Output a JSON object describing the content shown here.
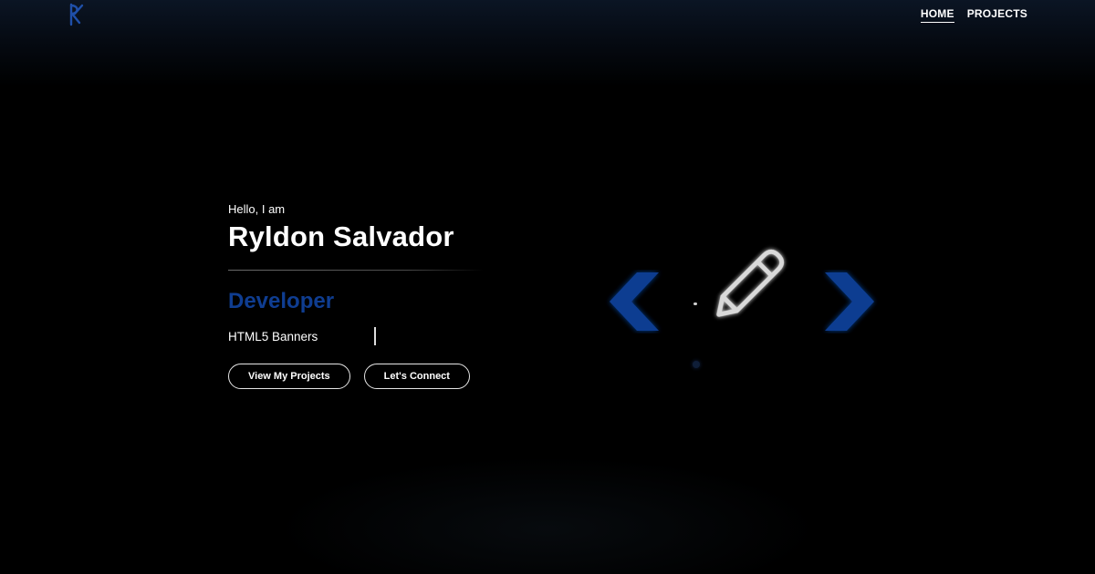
{
  "brand": {
    "logo_icon": "rs-logo-icon",
    "logo_color": "#1f4fa8"
  },
  "nav": {
    "items": [
      {
        "label": "HOME",
        "active": true
      },
      {
        "label": "PROJECTS",
        "active": false
      }
    ]
  },
  "hero": {
    "greeting": "Hello, I am",
    "name": "Ryldon Salvador",
    "role": "Developer",
    "typed_text": "HTML5 Banners",
    "buttons": {
      "view_projects": "View My Projects",
      "connect": "Let's Connect"
    }
  },
  "carousel": {
    "current_icon": "pencil-icon",
    "prev_icon": "chevron-left-icon",
    "next_icon": "chevron-right-icon",
    "arrow_color": "#0f3d91"
  },
  "colors": {
    "background": "#000000",
    "accent": "#0f3d91",
    "text": "#ffffff"
  }
}
